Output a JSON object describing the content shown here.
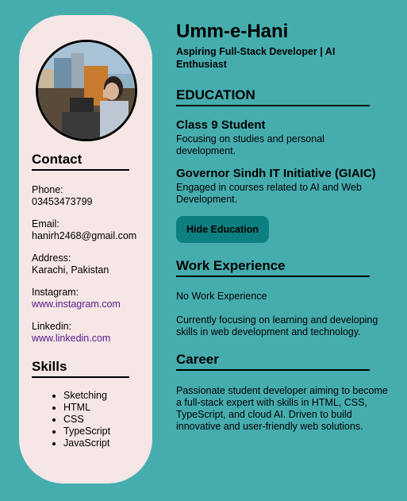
{
  "sidebar": {
    "contact_heading": "Contact",
    "phone_label": "Phone:",
    "phone_value": "03453473799",
    "email_label": "Email:",
    "email_value": "hanirh2468@gmail.com",
    "address_label": "Address:",
    "address_value": "Karachi, Pakistan",
    "instagram_label": "Instagram:",
    "instagram_value": "www.instagram.com",
    "linkedin_label": "Linkedin:",
    "linkedin_value": "www.linkedin.com",
    "skills_heading": "Skills",
    "skills": [
      "Sketching",
      "HTML",
      "CSS",
      "TypeScript",
      "JavaScript"
    ]
  },
  "main": {
    "name": "Umm-e-Hani",
    "tagline": "Aspiring Full-Stack Developer | AI Enthusiast",
    "education_heading": "EDUCATION",
    "education": [
      {
        "title": "Class 9 Student",
        "desc": "Focusing on studies and personal development."
      },
      {
        "title": "Governor Sindh IT Initiative (GIAIC)",
        "desc": "Engaged in courses related to AI and Web Development."
      }
    ],
    "hide_button": "Hide Education",
    "work_heading": "Work Experience",
    "work_none": "No Work Experience",
    "work_desc": "Currently focusing on learning and developing skills in web development and technology.",
    "career_heading": "Career",
    "career_desc": "Passionate student developer aiming to become a full-stack expert with skills in HTML, CSS, TypeScript, and cloud AI. Driven to build innovative and user-friendly web solutions."
  },
  "colors": {
    "background": "#46adaf",
    "sidebar": "#f6e6e6",
    "button": "#0c7f80",
    "link": "#551a8b"
  }
}
